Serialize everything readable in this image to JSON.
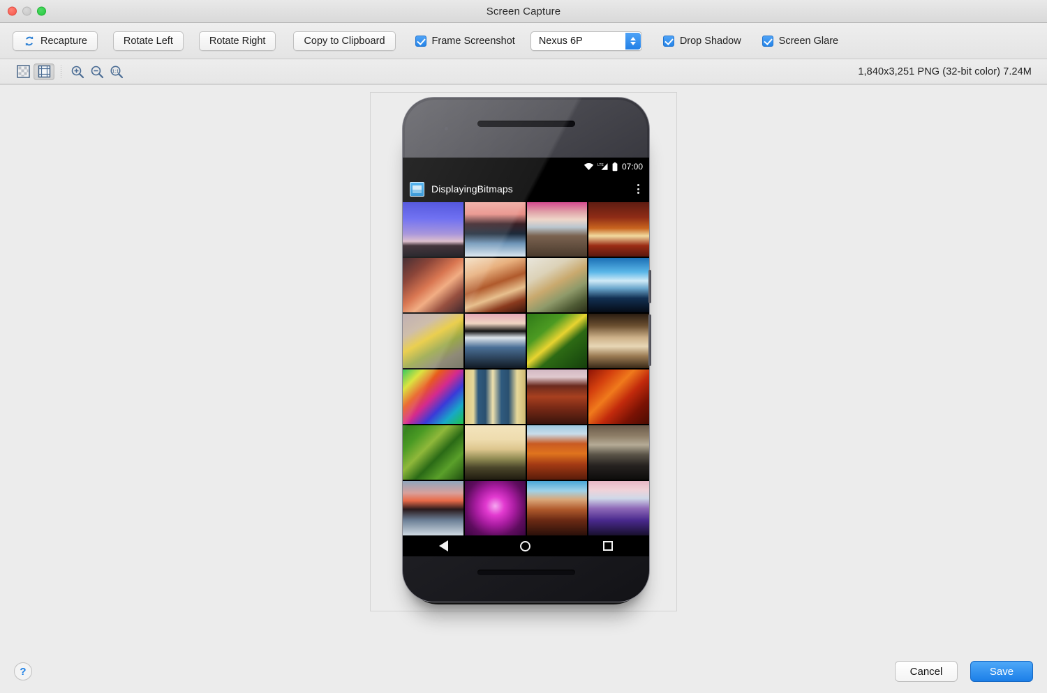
{
  "window": {
    "title": "Screen Capture",
    "controls": {
      "close": "close-button",
      "minimize": "minimize-button",
      "maximize": "maximize-button"
    }
  },
  "toolbar": {
    "recapture_label": "Recapture",
    "rotate_left_label": "Rotate Left",
    "rotate_right_label": "Rotate Right",
    "copy_label": "Copy to Clipboard",
    "frame_screenshot_label": "Frame Screenshot",
    "device_selected": "Nexus 6P",
    "device_options": [
      "Nexus 6P"
    ],
    "drop_shadow_label": "Drop Shadow",
    "screen_glare_label": "Screen Glare",
    "frame_screenshot_checked": true,
    "drop_shadow_checked": true,
    "screen_glare_checked": true
  },
  "viewtoolbar": {
    "transparency_toggle": "transparency-grid-toggle",
    "grid_toggle": "ruler-grid-toggle",
    "zoom_in": "zoom-in-button",
    "zoom_out": "zoom-out-button",
    "zoom_actual": "zoom-actual-size-button",
    "zoom_actual_label": "1:1",
    "image_info": "1,840x3,251 PNG (32-bit color) 7.24M"
  },
  "preview": {
    "device_name": "Nexus 6P",
    "status_bar": {
      "time": "07:00",
      "network_label": "LTE"
    },
    "app_title": "DisplayingBitmaps",
    "nav": {
      "back": "back-button",
      "home": "home-button",
      "recents": "recents-button"
    },
    "thumbnails": [
      "photographer-silhouette-blue-dusk",
      "sunset-trees-frozen-stream",
      "pink-sky-rocky-beach",
      "red-rock-canyon-layers",
      "slot-canyon-orange-glow",
      "wave-sand-dune-swirl",
      "driftwood-pale-shore",
      "blue-sunrise-over-ridge",
      "yellow-flower-with-bee",
      "lake-sunset-silhouette-rocks",
      "yellow-black-caterpillar-leaf",
      "chessboard-wooden-pieces",
      "rainbow-sunflower-field",
      "blue-shutters-yellow-wall",
      "canyon-river-bend-red-rock",
      "red-orange-maple-leaves",
      "aerial-green-farm-fields",
      "desert-dunes-golden-haze",
      "delicate-arch-red-rock",
      "dark-rocky-coastline",
      "sunset-bare-trees-ice",
      "magenta-firework-bloom",
      "canyonlands-mesa-overlook",
      "purple-tidal-flats-dusk"
    ]
  },
  "footer": {
    "help_label": "?",
    "cancel_label": "Cancel",
    "save_label": "Save"
  },
  "colors": {
    "accent_blue": "#1c7fe8",
    "window_bg": "#ececec",
    "toolbar_bg": "#e9e9e9",
    "screen_black": "#000000"
  }
}
